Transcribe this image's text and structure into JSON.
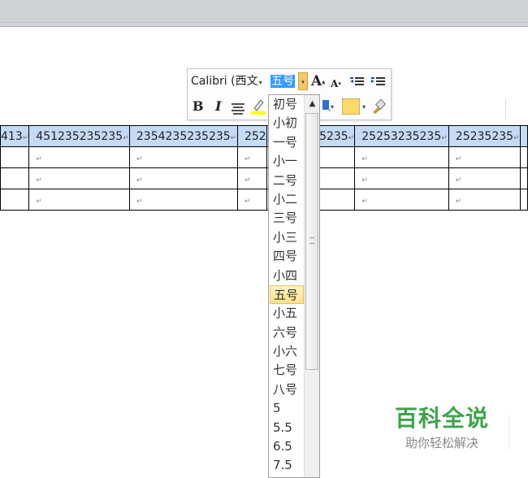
{
  "table": {
    "header": [
      "413",
      "451235235235",
      "2354235235235",
      "252",
      "5235",
      "25253235235",
      "25235235",
      ""
    ],
    "rows": 3,
    "cell_mark": "↵",
    "header_bg": "#c5daf5"
  },
  "toolbar": {
    "font_name": "Calibri (西文",
    "font_arrow": "▾",
    "font_size": "五号",
    "size_arrow": "▾",
    "grow_font": "A",
    "shrink_font": "A",
    "bold": "B",
    "italic": "I",
    "highlight_color": "#ffff00",
    "shading_color": "#ffd966"
  },
  "dropdown": {
    "items": [
      "初号",
      "小初",
      "一号",
      "小一",
      "二号",
      "小二",
      "三号",
      "小三",
      "四号",
      "小四",
      "五号",
      "小五",
      "六号",
      "小六",
      "七号",
      "八号",
      "5",
      "5.5",
      "6.5",
      "7.5"
    ],
    "selected": "五号",
    "scroll_up": "▲"
  },
  "watermark": {
    "title": "百科全说",
    "subtitle": "助你轻松解决",
    "color": "#3ea34a"
  }
}
